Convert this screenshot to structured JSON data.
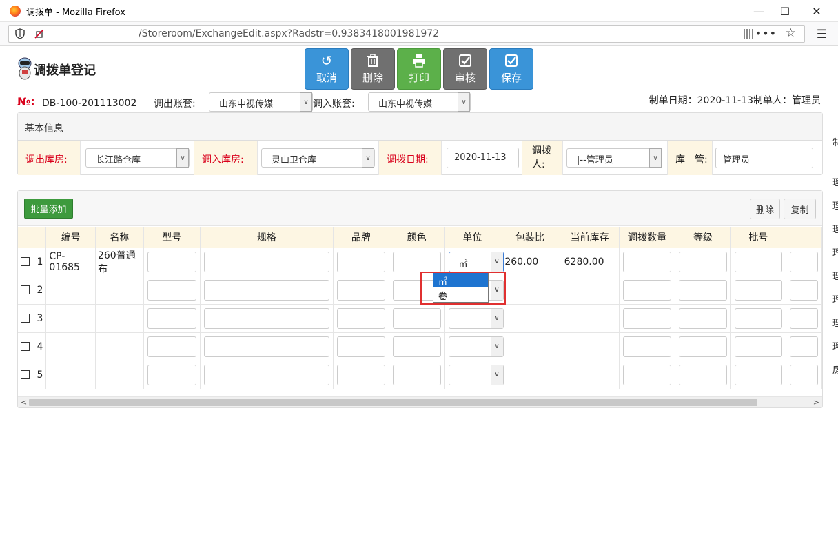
{
  "window": {
    "title": "调拨单 - Mozilla Firefox",
    "url": "/Storeroom/ExchangeEdit.aspx?Radstr=0.9383418001981972"
  },
  "toolbar": {
    "page_title": "调拨单登记",
    "buttons": [
      {
        "label": "取消",
        "icon": "undo-icon"
      },
      {
        "label": "删除",
        "icon": "trash-icon"
      },
      {
        "label": "打印",
        "icon": "print-icon"
      },
      {
        "label": "审核",
        "icon": "check-square-icon"
      },
      {
        "label": "保存",
        "icon": "check-square-icon"
      }
    ]
  },
  "header": {
    "no_label": "№:",
    "doc_no": "DB-100-201113002",
    "out_account_label": "调出账套:",
    "out_account_value": "山东中视传媒",
    "in_account_label": "调入账套:",
    "in_account_value": "山东中视传媒",
    "meta": "制单日期：2020-11-13制单人：管理员"
  },
  "basic": {
    "title": "基本信息",
    "out_store_label": "调出库房:",
    "out_store_value": "长江路仓库",
    "in_store_label": "调入库房:",
    "in_store_value": "灵山卫仓库",
    "date_label": "调拨日期:",
    "date_value": "2020-11-13",
    "person_label": "调拨人:",
    "person_value": "|--管理员",
    "keeper_label": "库　管:",
    "keeper_value": "管理员"
  },
  "grid": {
    "batch_add": "批量添加",
    "delete": "删除",
    "copy": "复制",
    "columns": [
      "编号",
      "名称",
      "型号",
      "规格",
      "品牌",
      "颜色",
      "单位",
      "包装比",
      "当前库存",
      "调拨数量",
      "等级",
      "批号"
    ],
    "rows": [
      {
        "no": "1",
        "code": "CP-01685",
        "name": "260普通布",
        "unit": "㎡",
        "pack": "260.00",
        "stock": "6280.00"
      },
      {
        "no": "2",
        "code": "",
        "name": "",
        "unit": "",
        "pack": "",
        "stock": ""
      },
      {
        "no": "3",
        "code": "",
        "name": "",
        "unit": "",
        "pack": "",
        "stock": ""
      },
      {
        "no": "4",
        "code": "",
        "name": "",
        "unit": "",
        "pack": "",
        "stock": ""
      },
      {
        "no": "5",
        "code": "",
        "name": "",
        "unit": "",
        "pack": "",
        "stock": ""
      }
    ],
    "unit_options": [
      "㎡",
      "卷"
    ],
    "selected_unit_option": "㎡"
  },
  "right_edge": [
    "制",
    "理",
    "理",
    "理",
    "理",
    "理",
    "理",
    "理",
    "理",
    "房"
  ],
  "colors": {
    "accent_blue": "#3a94d8",
    "accent_gray": "#707070",
    "accent_green": "#5cb04a",
    "required_red": "#d9001b",
    "highlight_red": "#e03030"
  }
}
